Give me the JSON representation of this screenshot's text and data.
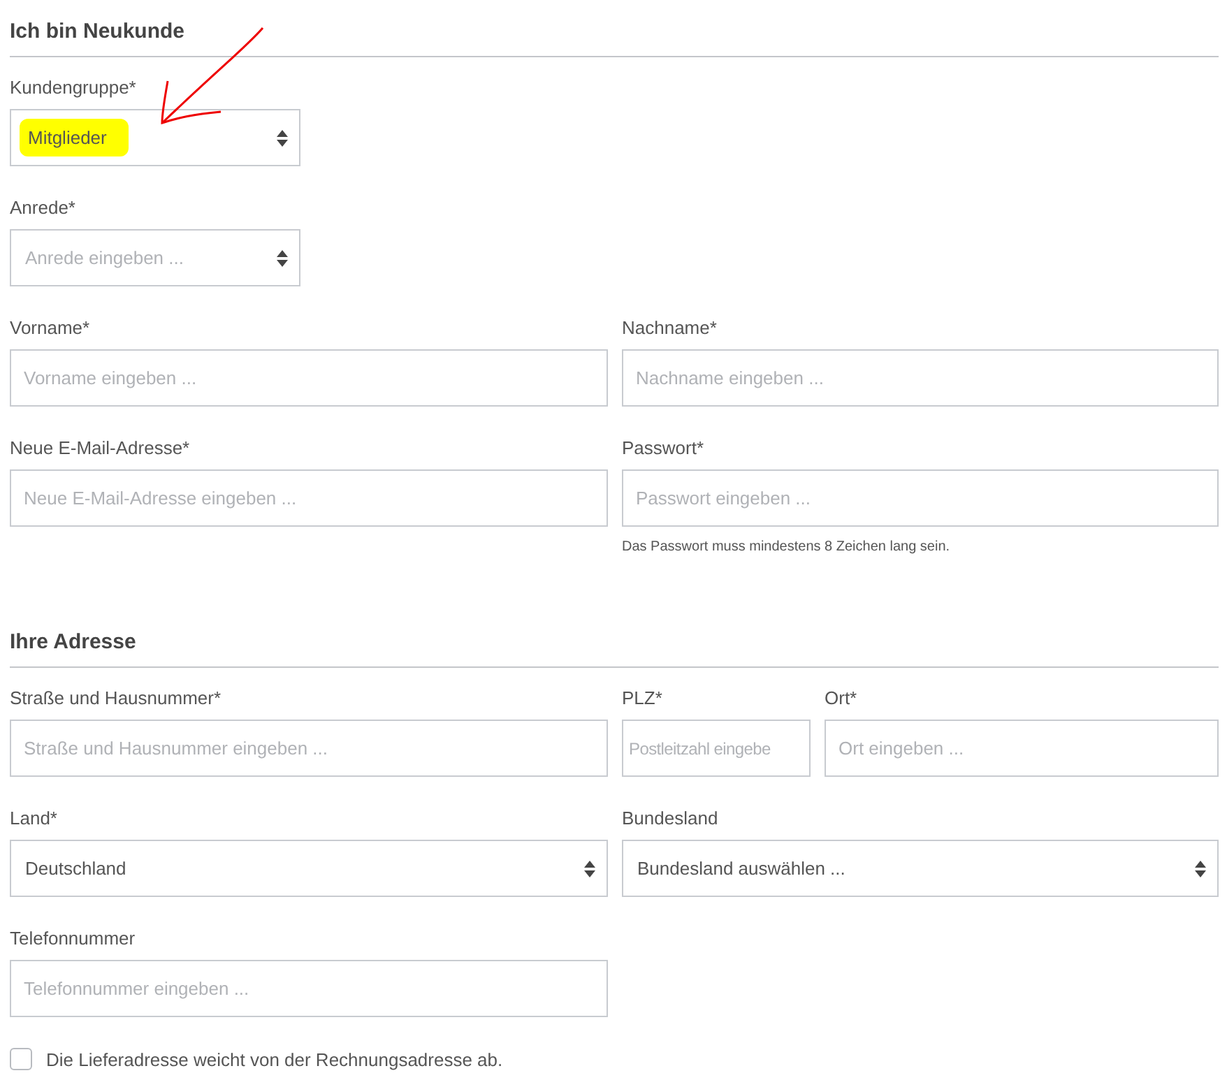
{
  "sections": [
    {
      "title": "Ich bin Neukunde",
      "rows": [
        {
          "fields": [
            {
              "label": "Kundengruppe*",
              "kind": "select",
              "value": "Mitglieder",
              "highlighted": true
            }
          ]
        },
        {
          "fields": [
            {
              "label": "Anrede*",
              "kind": "select",
              "placeholder": "Anrede eingeben ..."
            }
          ]
        },
        {
          "fields": [
            {
              "label": "Vorname*",
              "kind": "text",
              "placeholder": "Vorname eingeben ..."
            },
            {
              "label": "Nachname*",
              "kind": "text",
              "placeholder": "Nachname eingeben ..."
            }
          ]
        },
        {
          "fields": [
            {
              "label": "Neue E-Mail-Adresse*",
              "kind": "text",
              "placeholder": "Neue E-Mail-Adresse eingeben ..."
            },
            {
              "label": "Passwort*",
              "kind": "password",
              "placeholder": "Passwort eingeben ...",
              "hint": "Das Passwort muss mindestens 8 Zeichen lang sein."
            }
          ]
        }
      ]
    },
    {
      "title": "Ihre Adresse",
      "rows": [
        {
          "fields": [
            {
              "label": "Straße und Hausnummer*",
              "kind": "text",
              "placeholder": "Straße und Hausnummer eingeben ..."
            },
            {
              "label": "PLZ*",
              "kind": "text",
              "placeholder": "Postleitzahl eingebe"
            },
            {
              "label": "Ort*",
              "kind": "text",
              "placeholder": "Ort eingeben ..."
            }
          ]
        },
        {
          "fields": [
            {
              "label": "Land*",
              "kind": "select",
              "value": "Deutschland"
            },
            {
              "label": "Bundesland",
              "kind": "select",
              "value": "Bundesland auswählen ..."
            }
          ]
        },
        {
          "fields": [
            {
              "label": "Telefonnummer",
              "kind": "text",
              "placeholder": "Telefonnummer eingeben ..."
            }
          ]
        }
      ]
    }
  ],
  "checkbox": {
    "label": "Die Lieferadresse weicht von der Rechnungsadresse ab.",
    "checked": false
  },
  "annotation_arrow": true
}
